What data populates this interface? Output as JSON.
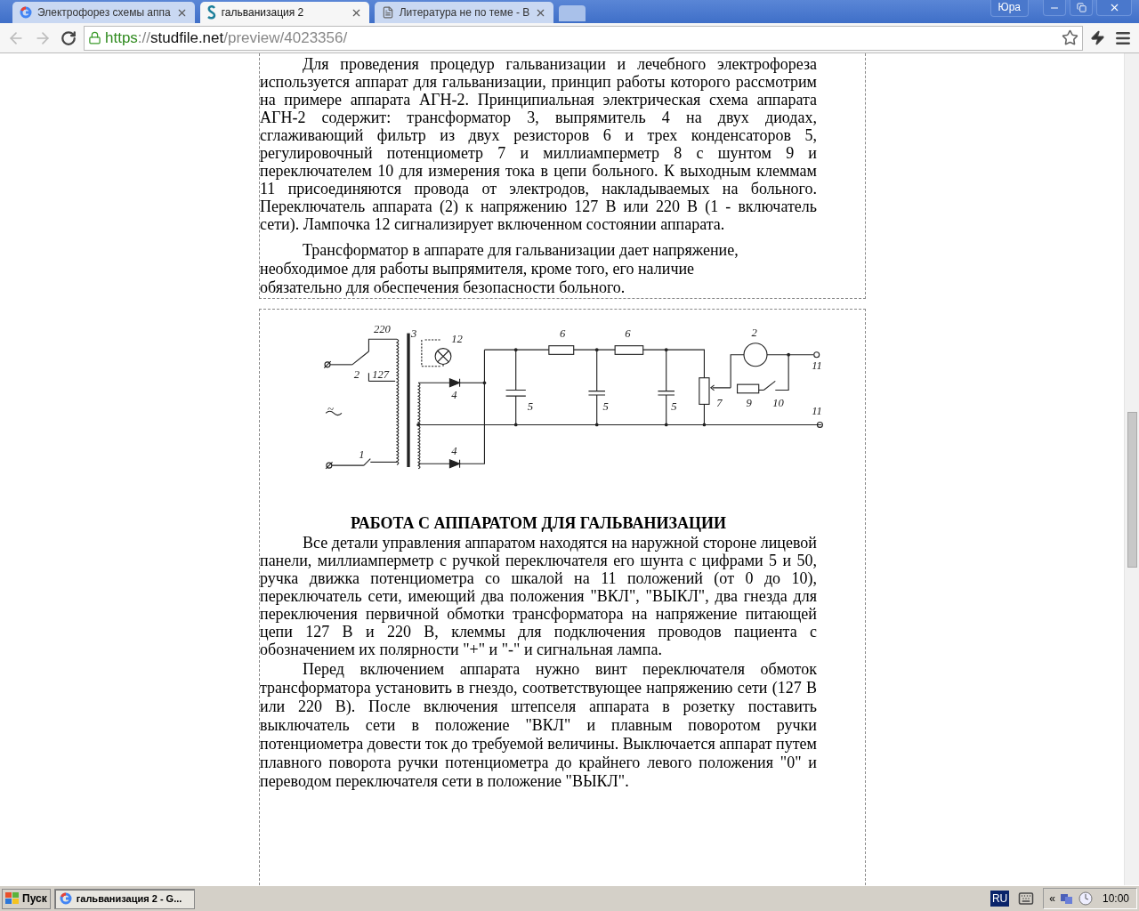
{
  "browser": {
    "tabs": [
      {
        "title": "Электрофорез схемы аппа",
        "selected": false,
        "kind": "google"
      },
      {
        "title": "гальванизация 2",
        "selected": true,
        "kind": "site"
      },
      {
        "title": "Литература не по теме - В",
        "selected": false,
        "kind": "page"
      }
    ],
    "profile": "Юра",
    "address": {
      "scheme": "https",
      "separator": "://",
      "host": "studfile.net",
      "path": "/preview/4023356/"
    }
  },
  "document": {
    "section_1": {
      "paragraphs": [
        {
          "kind": "justified",
          "text": "Для проведения процедур гальванизации и лечебного электрофореза используется аппарат для гальванизации, принцип работы которого рассмотрим на примере аппарата АГН-2. Принципиальная электрическая схема аппарата АГН-2 содержит: трансформатор 3, выпрямитель 4 на двух диодах, сглаживающий фильтр из двух резисторов 6 и трех конденсаторов 5, регулировочный потенциометр 7 и миллиамперметр 8 с шунтом 9 и переключателем 10 для измерения тока в цепи больного. К выходным клеммам 11 присоединяются провода от электродов, накладываемых на больного. Переключатель аппарата (2) к напряжению 127 В или 220 В (1 - включатель сети). Лампочка 12 сигнализирует включенном состоянии аппарата."
        },
        {
          "kind": "plain",
          "text": "Трансформатор в аппарате для гальванизации дает напряжение, необходимое для работы выпрямителя, кроме того, его наличие обязательно для обеспечения безопасности больного."
        }
      ]
    },
    "section_2": {
      "diagram_labels": [
        "220",
        "3",
        "12",
        "2",
        "127",
        "~",
        "1",
        "4",
        "4",
        "6",
        "6",
        "5",
        "5",
        "5",
        "7",
        "2",
        "9",
        "10",
        "11",
        "11"
      ],
      "heading": "РАБОТА С АППАРАТОМ ДЛЯ ГАЛЬВАНИЗАЦИИ",
      "paragraphs": [
        {
          "kind": "justified",
          "text": "Все детали управления аппаратом находятся на наружной стороне лицевой панели, миллиамперметр с ручкой переключателя его шунта с цифрами 5 и 50, ручка движка потенциометра со шкалой на 11 положений (от 0 до 10), переключатель сети, имеющий два положения \"ВКЛ\", \"ВЫКЛ\", два гнезда для переключения первичной обмотки трансформатора на напряжение питающей цепи 127 В и 220 В, клеммы для подключения проводов пациента с обозначением их полярности \"+\" и \"-\" и сигнальная лампа."
        },
        {
          "kind": "justified",
          "text": "Перед включением аппарата нужно винт переключателя обмоток трансформатора установить в гнездо, соответствующее напряжению сети (127 В или 220 В). После включения штепселя аппарата в розетку поставить выключатель сети в положение \"ВКЛ\" и плавным поворотом ручки потенциометра довести ток до требуемой величины. Выключается аппарат путем плавного поворота ручки потенциометра до крайнего левого положения \"0\" и переводом переключателя сети в положение \"ВЫКЛ\"."
        }
      ]
    }
  },
  "taskbar": {
    "start": "Пуск",
    "windows": [
      {
        "title": "гальванизация 2 - G...",
        "selected": true
      }
    ],
    "language": "RU",
    "tray_expand": "«",
    "clock": "10:00"
  }
}
